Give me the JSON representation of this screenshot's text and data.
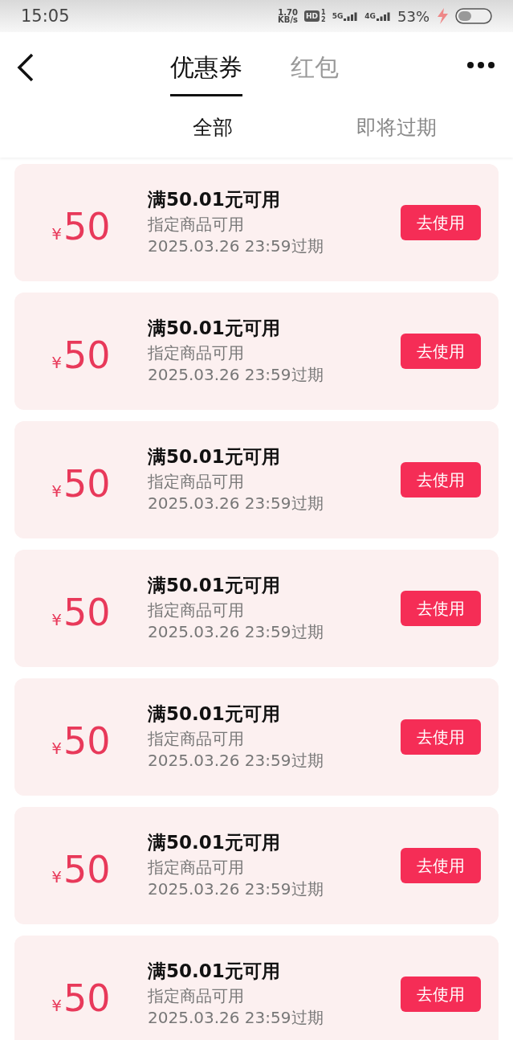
{
  "status_bar": {
    "time": "15:05",
    "speed": "1.70",
    "speed_unit": "KB/s",
    "hd": "HD",
    "hd_sims": [
      "1",
      "2"
    ],
    "networks": [
      "5G",
      "4G"
    ],
    "battery": "53%"
  },
  "tabs": [
    {
      "label": "优惠券",
      "selected": true
    },
    {
      "label": "红包",
      "selected": false
    }
  ],
  "filters": [
    {
      "label": "全部",
      "selected": true
    },
    {
      "label": "即将过期",
      "selected": false
    }
  ],
  "coupons": [
    {
      "currency": "¥",
      "amount": "50",
      "condition": "满50.01元可用",
      "scope": "指定商品可用",
      "expiry": "2025.03.26 23:59过期",
      "button": "去使用"
    },
    {
      "currency": "¥",
      "amount": "50",
      "condition": "满50.01元可用",
      "scope": "指定商品可用",
      "expiry": "2025.03.26 23:59过期",
      "button": "去使用"
    },
    {
      "currency": "¥",
      "amount": "50",
      "condition": "满50.01元可用",
      "scope": "指定商品可用",
      "expiry": "2025.03.26 23:59过期",
      "button": "去使用"
    },
    {
      "currency": "¥",
      "amount": "50",
      "condition": "满50.01元可用",
      "scope": "指定商品可用",
      "expiry": "2025.03.26 23:59过期",
      "button": "去使用"
    },
    {
      "currency": "¥",
      "amount": "50",
      "condition": "满50.01元可用",
      "scope": "指定商品可用",
      "expiry": "2025.03.26 23:59过期",
      "button": "去使用"
    },
    {
      "currency": "¥",
      "amount": "50",
      "condition": "满50.01元可用",
      "scope": "指定商品可用",
      "expiry": "2025.03.26 23:59过期",
      "button": "去使用"
    },
    {
      "currency": "¥",
      "amount": "50",
      "condition": "满50.01元可用",
      "scope": "指定商品可用",
      "expiry": "2025.03.26 23:59过期",
      "button": "去使用"
    }
  ]
}
